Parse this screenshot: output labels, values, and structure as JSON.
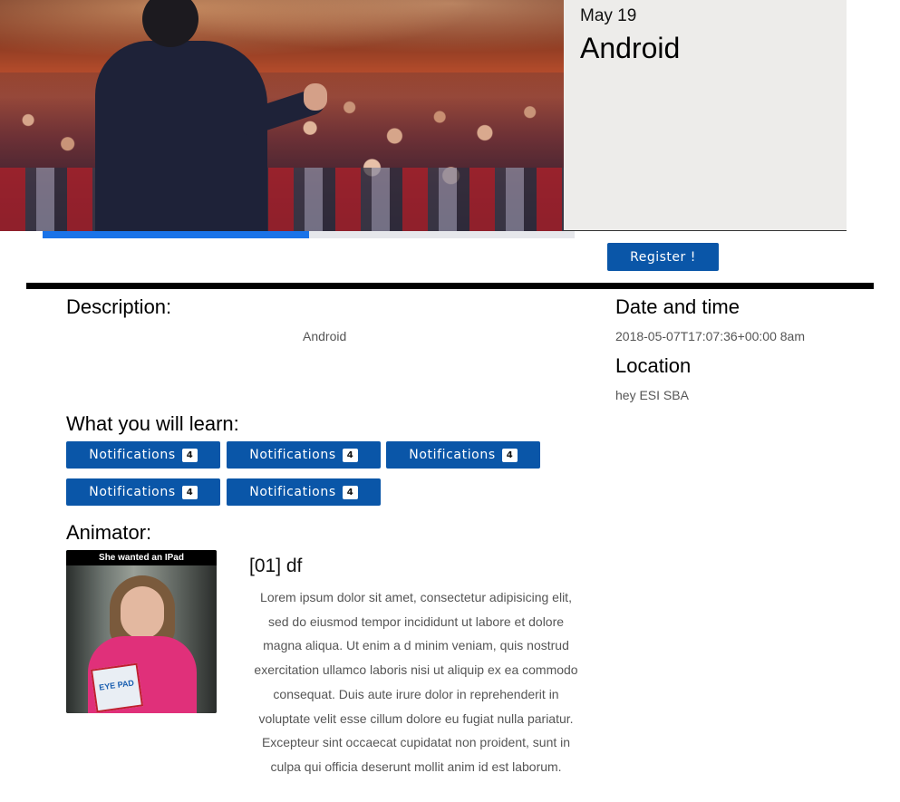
{
  "event": {
    "date": "May 19",
    "title": "Android",
    "progress_percent": 50,
    "register_label": "Register !"
  },
  "description": {
    "heading": "Description:",
    "text": "Android"
  },
  "datetime": {
    "heading": "Date and time",
    "value": "2018-05-07T17:07:36+00:00 8am"
  },
  "location": {
    "heading": "Location",
    "value": "hey ESI SBA"
  },
  "learn": {
    "heading": "What you will learn:",
    "items": [
      {
        "label": "Notifications",
        "count": "4"
      },
      {
        "label": "Notifications",
        "count": "4"
      },
      {
        "label": "Notifications",
        "count": "4"
      },
      {
        "label": "Notifications",
        "count": "4"
      },
      {
        "label": "Notifications",
        "count": "4"
      }
    ]
  },
  "animator": {
    "heading": "Animator:",
    "photo_caption": "She wanted an IPad",
    "photo_pad_text": "EYE PAD",
    "name": "[01] df",
    "bio": "Lorem ipsum dolor sit amet, consectetur adipisicing elit, sed do eiusmod tempor incididunt ut labore et dolore magna aliqua. Ut enim a d minim veniam, quis nostrud exercitation ullamco laboris nisi ut aliquip ex ea commodo consequat. Duis aute irure dolor in reprehenderit in voluptate velit esse cillum dolore eu fugiat nulla pariatur. Excepteur sint occaecat cupidatat non proident, sunt in culpa qui officia deserunt mollit anim id est laborum."
  },
  "colors": {
    "primary_button": "#0a56a8",
    "progress_fill": "#1a73e8",
    "progress_track": "#e6e7eb",
    "info_card_bg": "#edecea"
  }
}
